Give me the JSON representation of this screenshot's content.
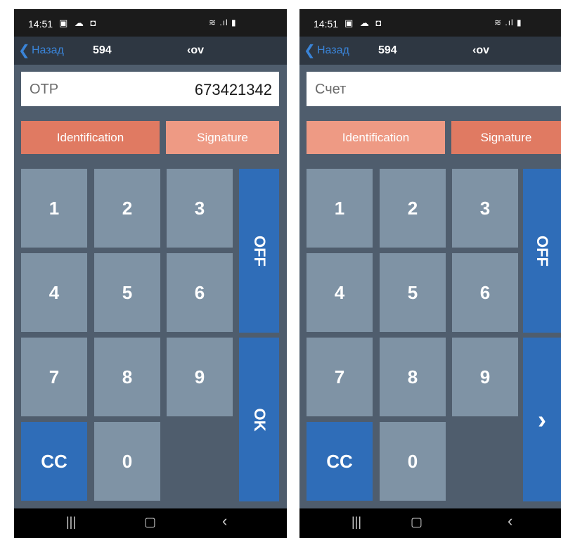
{
  "screens": [
    {
      "status_time": "14:51",
      "status_left_icons": "▣ ☁ ◘",
      "status_right_icons": "≋ .ıl ▮",
      "back_label": "Назад",
      "nav_number": "594",
      "nav_title": "‹ov",
      "field_label": "OTP",
      "field_value": "673421342",
      "btn_identification": "Identification",
      "btn_signature": "Signature",
      "active_mode": "identification",
      "keys": [
        "1",
        "2",
        "3",
        "4",
        "5",
        "6",
        "7",
        "8",
        "9"
      ],
      "key_cc": "CC",
      "key_0": "0",
      "side_top": "OFF",
      "side_bottom": "OK",
      "sys_recent": "|||",
      "sys_home": "▢",
      "sys_back": "‹"
    },
    {
      "status_time": "14:51",
      "status_left_icons": "▣ ☁ ◘",
      "status_right_icons": "≋ .ıl ▮",
      "back_label": "Назад",
      "nav_number": "594",
      "nav_title": "‹ov",
      "field_label": "Счет",
      "field_value": "",
      "btn_identification": "Identification",
      "btn_signature": "Signature",
      "active_mode": "signature",
      "keys": [
        "1",
        "2",
        "3",
        "4",
        "5",
        "6",
        "7",
        "8",
        "9"
      ],
      "key_cc": "CC",
      "key_0": "0",
      "side_top": "OFF",
      "side_bottom": "›",
      "sys_recent": "|||",
      "sys_home": "▢",
      "sys_back": "‹"
    }
  ],
  "colors": {
    "accent_blue": "#2f6db8",
    "key_grey": "#7f93a5",
    "mode_active": "#e07a62",
    "mode_inactive": "#ee9a84",
    "panel": "#4f5d6d"
  }
}
